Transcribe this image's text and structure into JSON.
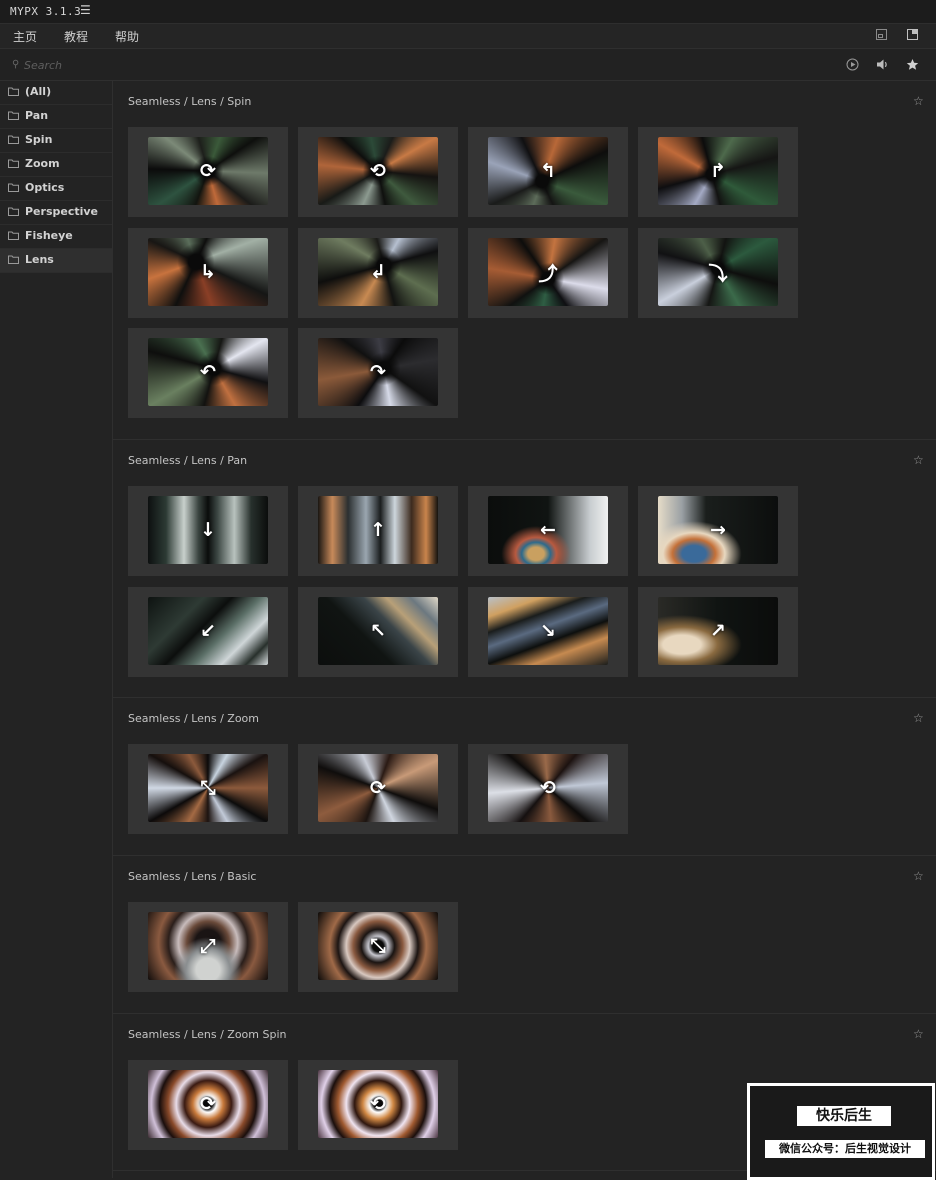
{
  "app": {
    "title": "MYPX 3.1.3",
    "menu_icon": "☰"
  },
  "nav": {
    "items": [
      "主页",
      "教程",
      "帮助"
    ]
  },
  "search": {
    "placeholder": "Search"
  },
  "sidebar": {
    "items": [
      {
        "label": "(All)"
      },
      {
        "label": "Pan"
      },
      {
        "label": "Spin"
      },
      {
        "label": "Zoom"
      },
      {
        "label": "Optics"
      },
      {
        "label": "Perspective"
      },
      {
        "label": "Fisheye"
      },
      {
        "label": "Lens",
        "active": true
      }
    ]
  },
  "sections": [
    {
      "title": "Seamless / Lens / Spin",
      "tiles": [
        {
          "icon": "spin-cw-icon",
          "glyph": "⟳"
        },
        {
          "icon": "spin-ccw-icon",
          "glyph": "⟲"
        },
        {
          "icon": "curve-arrow-icon",
          "glyph": "↰"
        },
        {
          "icon": "curve-arrow-icon",
          "glyph": "↱"
        },
        {
          "icon": "curve-arrow-icon",
          "glyph": "↳"
        },
        {
          "icon": "curve-arrow-icon",
          "glyph": "↲"
        },
        {
          "icon": "curve-arrow-icon",
          "glyph": "⤴"
        },
        {
          "icon": "curve-arrow-icon",
          "glyph": "⤵"
        },
        {
          "icon": "curve-arrow-icon",
          "glyph": "↶"
        },
        {
          "icon": "curve-arrow-icon",
          "glyph": "↷"
        }
      ]
    },
    {
      "title": "Seamless / Lens / Pan",
      "tiles": [
        {
          "icon": "arrow-down-icon",
          "glyph": "↓"
        },
        {
          "icon": "arrow-up-icon",
          "glyph": "↑"
        },
        {
          "icon": "arrow-left-icon",
          "glyph": "←"
        },
        {
          "icon": "arrow-right-icon",
          "glyph": "→"
        },
        {
          "icon": "arrow-down-left-icon",
          "glyph": "↙"
        },
        {
          "icon": "arrow-up-left-icon",
          "glyph": "↖"
        },
        {
          "icon": "arrow-down-right-icon",
          "glyph": "↘"
        },
        {
          "icon": "arrow-up-right-icon",
          "glyph": "↗"
        }
      ]
    },
    {
      "title": "Seamless / Lens / Zoom",
      "tiles": [
        {
          "icon": "compress-icon",
          "glyph": "⤡"
        },
        {
          "icon": "rotate-icon",
          "glyph": "⟳"
        },
        {
          "icon": "rotate-icon",
          "glyph": "⟲"
        }
      ]
    },
    {
      "title": "Seamless / Lens / Basic",
      "tiles": [
        {
          "icon": "expand-icon",
          "glyph": "⤢"
        },
        {
          "icon": "compress-icon",
          "glyph": "⤡"
        }
      ]
    },
    {
      "title": "Seamless / Lens / Zoom Spin",
      "tiles": [
        {
          "icon": "spin-cw-icon",
          "glyph": "⟳"
        },
        {
          "icon": "spin-ccw-icon",
          "glyph": "⟲"
        }
      ]
    }
  ],
  "watermark": {
    "top": "快乐后生",
    "bottom": "微信公众号：后生视觉设计"
  },
  "colors": {
    "bg": "#232323",
    "tile": "#343434",
    "text": "#c8c8c8"
  }
}
